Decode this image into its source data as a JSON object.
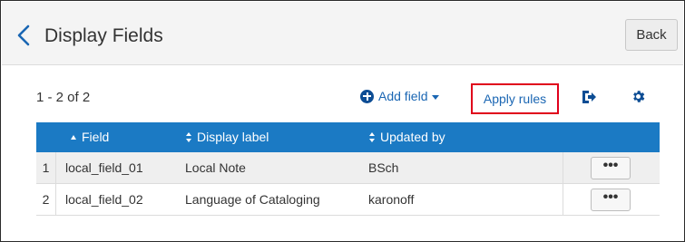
{
  "header": {
    "title": "Display Fields",
    "back_label": "Back"
  },
  "toolbar": {
    "count_label": "1 - 2 of 2",
    "add_field_label": "Add field",
    "apply_rules_label": "Apply rules"
  },
  "table": {
    "columns": {
      "field": "Field",
      "display_label": "Display label",
      "updated_by": "Updated by"
    },
    "rows": [
      {
        "num": "1",
        "field": "local_field_01",
        "display_label": "Local Note",
        "updated_by": "BSch",
        "actions": "•••"
      },
      {
        "num": "2",
        "field": "local_field_02",
        "display_label": "Language of Cataloging",
        "updated_by": "karonoff",
        "actions": "•••"
      }
    ]
  },
  "icons": {
    "back": "chevron-left-icon",
    "add": "plus-circle-icon",
    "export": "export-icon",
    "settings": "gear-icon"
  },
  "colors": {
    "accent": "#1b7ac4",
    "link": "#1a66b3",
    "highlight_border": "#e0001b",
    "header_bg": "#f4f4f4"
  }
}
